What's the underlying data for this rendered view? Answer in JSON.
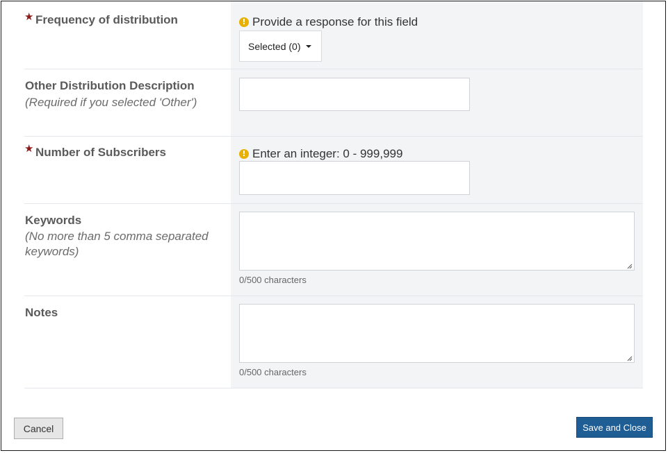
{
  "form": {
    "frequency": {
      "required_marker": "★",
      "label": "Frequency of distribution",
      "warning": "Provide a response for this field",
      "dropdown_value": "Selected (0)"
    },
    "other_description": {
      "label": "Other Distribution Description",
      "sublabel": "(Required if you selected 'Other')",
      "value": ""
    },
    "subscribers": {
      "required_marker": "★",
      "label": "Number of Subscribers",
      "warning": "Enter an integer: 0 - 999,999",
      "value": ""
    },
    "keywords": {
      "label": "Keywords",
      "sublabel": "(No more than 5 comma separated keywords)",
      "value": "",
      "counter": "0/500 characters"
    },
    "notes": {
      "label": "Notes",
      "value": "",
      "counter": "0/500 characters"
    }
  },
  "actions": {
    "cancel_label": "Cancel",
    "save_label": "Save and Close"
  },
  "colors": {
    "required_star": "#8b1a1a",
    "warning_icon": "#e8b100",
    "primary_button": "#1f5d95",
    "field_panel": "#f2f4f6"
  }
}
